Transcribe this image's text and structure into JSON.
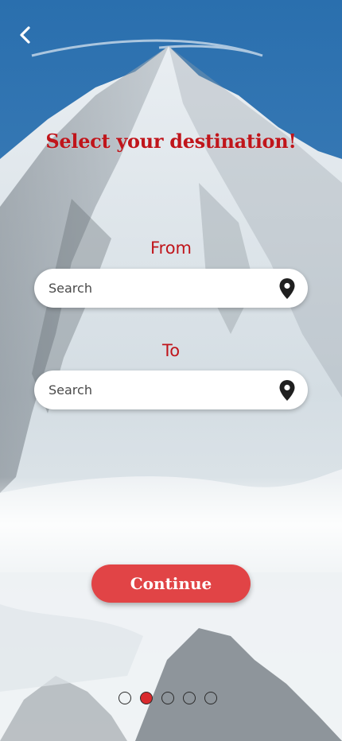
{
  "screen": {
    "background_image": "snowy-mountain-peak-photo",
    "title": "Select your destination!",
    "back_icon": "chevron-left-icon"
  },
  "from": {
    "label": "From",
    "placeholder": "Search",
    "icon": "map-pin-icon"
  },
  "to": {
    "label": "To",
    "placeholder": "Search",
    "icon": "map-pin-icon"
  },
  "continue": {
    "label": "Continue"
  },
  "pagination": {
    "total": 5,
    "active_index": 1
  },
  "colors": {
    "accent_red": "#c0151b",
    "button_red": "#e14446",
    "active_dot": "#d92a2e"
  }
}
